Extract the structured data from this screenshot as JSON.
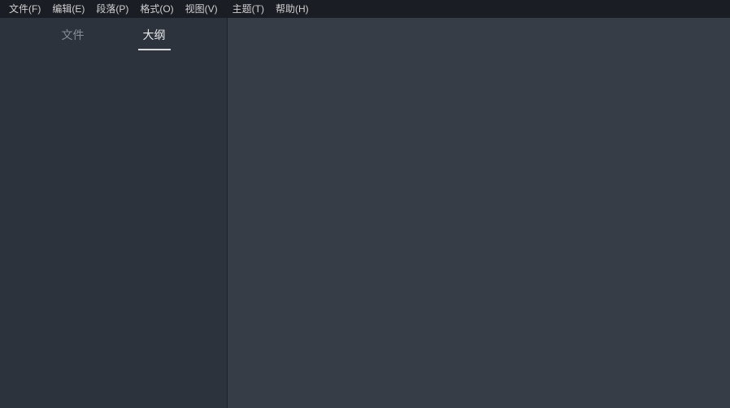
{
  "menubar": {
    "items": [
      "文件(F)",
      "编辑(E)",
      "段落(P)",
      "格式(O)",
      "视图(V)",
      "主题(T)",
      "帮助(H)"
    ]
  },
  "sidebar": {
    "tabs": [
      {
        "label": "文件",
        "active": false
      },
      {
        "label": "大纲",
        "active": true
      }
    ]
  }
}
